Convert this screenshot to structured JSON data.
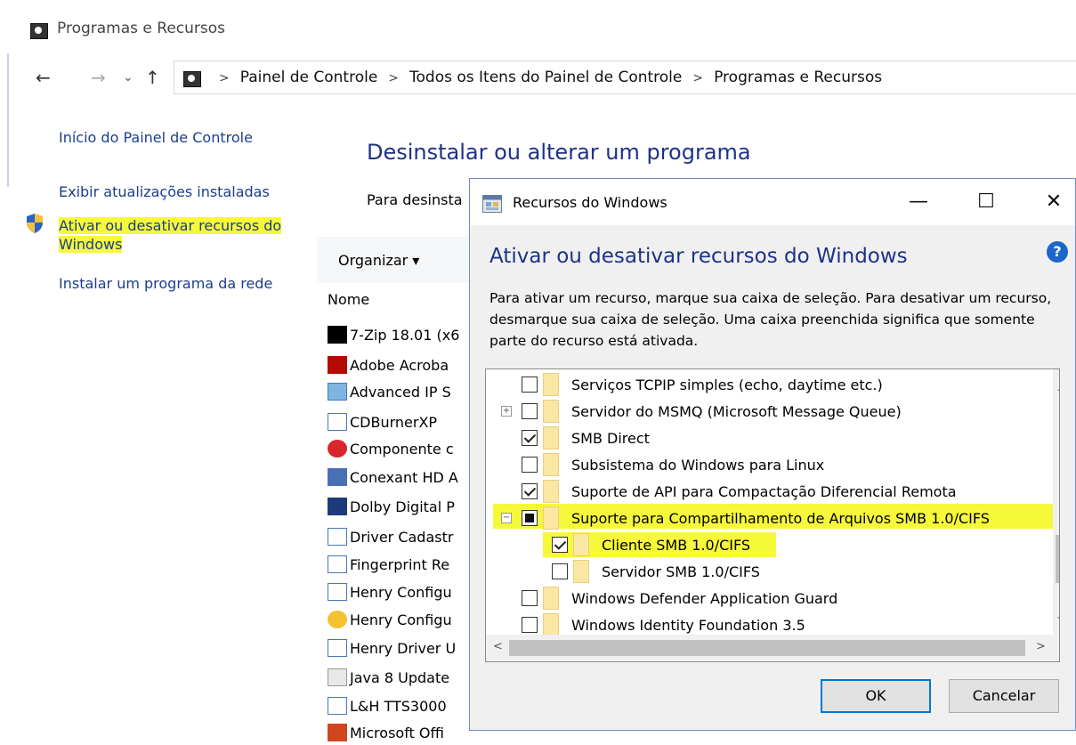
{
  "window": {
    "title": "Programas e Recursos"
  },
  "address_bar": {
    "breadcrumb": [
      "Painel de Controle",
      "Todos os Itens do Painel de Controle",
      "Programas e Recursos"
    ],
    "separator": ">",
    "back": "←",
    "forward": "→",
    "recent": "⌄",
    "up": "↑"
  },
  "left_panel": {
    "home": "Início do Painel de Controle",
    "updates": "Exibir atualizações instaladas",
    "features_line1": "Ativar ou desativar recursos do",
    "features_line2": "Windows",
    "network_install": "Instalar um programa da rede"
  },
  "main": {
    "title": "Desinstalar ou alterar um programa",
    "subtitle": "Para desinsta",
    "organize": "Organizar ▾",
    "column_name": "Nome",
    "programs": [
      "7-Zip 18.01 (x6",
      "Adobe Acroba",
      "Advanced IP S",
      "CDBurnerXP",
      "Componente c",
      "Conexant HD A",
      "Dolby Digital P",
      "Driver Cadastr",
      "Fingerprint Re",
      "Henry Configu",
      "Henry Configu",
      "Henry Driver U",
      "Java 8 Update",
      "L&H TTS3000",
      "Microsoft Offi"
    ]
  },
  "dialog": {
    "title": "Recursos do Windows",
    "minimize": "—",
    "maximize": "☐",
    "close": "✕",
    "heading": "Ativar ou desativar recursos do Windows",
    "help": "?",
    "description": "Para ativar um recurso, marque sua caixa de seleção. Para desativar um recurso, desmarque sua caixa de seleção. Uma caixa preenchida significa que somente parte do recurso está ativada.",
    "features": [
      {
        "label": "Serviços TCPIP simples (echo, daytime etc.)",
        "state": "unchecked",
        "level": 0,
        "expander": ""
      },
      {
        "label": "Servidor do MSMQ (Microsoft Message Queue)",
        "state": "unchecked",
        "level": 0,
        "expander": "+"
      },
      {
        "label": "SMB Direct",
        "state": "checked",
        "level": 0,
        "expander": ""
      },
      {
        "label": "Subsistema do Windows para Linux",
        "state": "unchecked",
        "level": 0,
        "expander": ""
      },
      {
        "label": "Suporte de API para Compactação Diferencial Remota",
        "state": "checked",
        "level": 0,
        "expander": ""
      },
      {
        "label": "Suporte para Compartilhamento de Arquivos SMB 1.0/CIFS",
        "state": "partial",
        "level": 0,
        "expander": "−"
      },
      {
        "label": "Cliente SMB 1.0/CIFS",
        "state": "checked",
        "level": 1,
        "expander": ""
      },
      {
        "label": "Servidor SMB 1.0/CIFS",
        "state": "unchecked",
        "level": 1,
        "expander": ""
      },
      {
        "label": "Windows Defender Application Guard",
        "state": "unchecked",
        "level": 0,
        "expander": ""
      },
      {
        "label": "Windows Identity Foundation 3.5",
        "state": "unchecked",
        "level": 0,
        "expander": ""
      }
    ],
    "ok": "OK",
    "cancel": "Cancelar"
  },
  "colors": {
    "highlight": "#f6f83a",
    "heading_blue": "#1e3287",
    "link_blue": "#1a3e8c",
    "dialog_border": "#6a8fc0",
    "ok_focus": "#0078d7"
  }
}
